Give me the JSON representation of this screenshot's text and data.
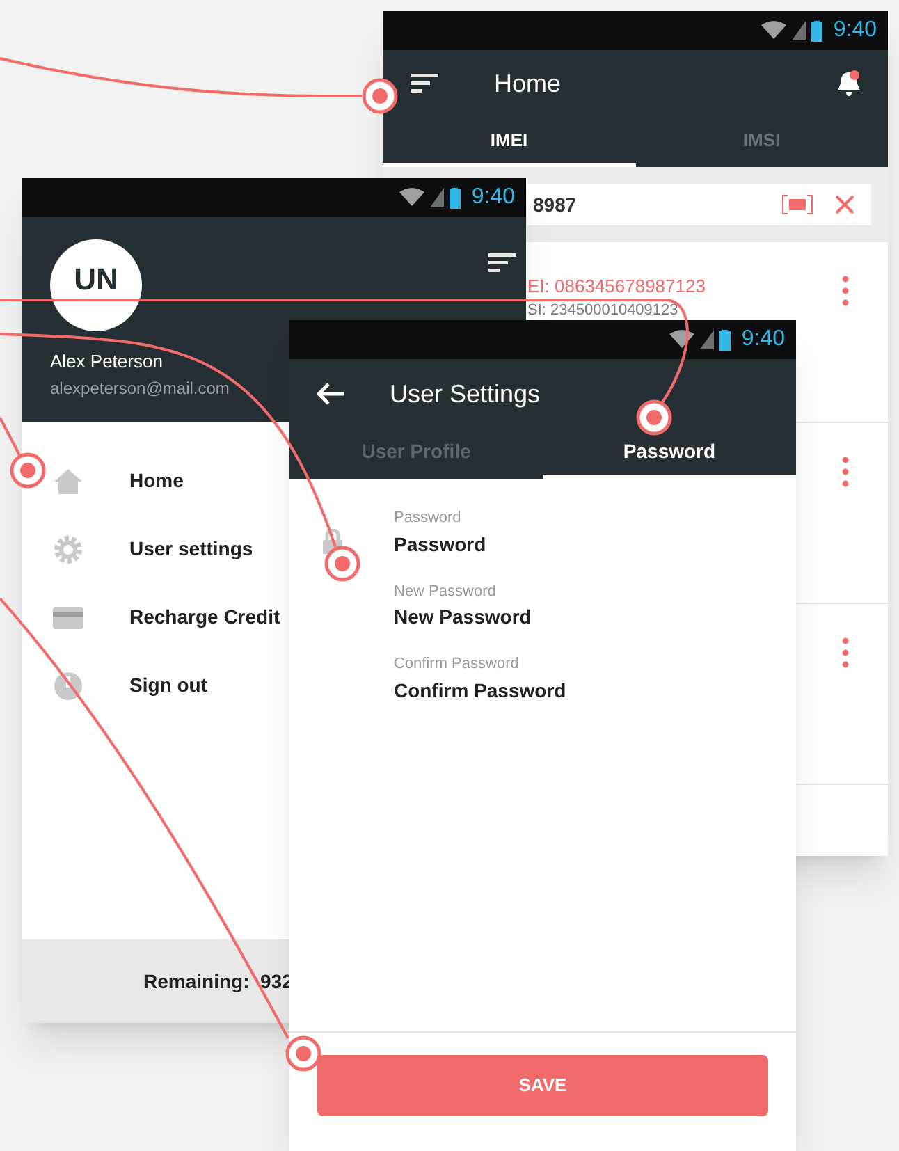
{
  "home_screen": {
    "status_time": "9:40",
    "title": "Home",
    "tabs": [
      {
        "label": "IMEI",
        "selected": true
      },
      {
        "label": "IMSI",
        "selected": false
      }
    ],
    "search": {
      "value": "8987"
    },
    "rows": [
      {
        "kind": "entry",
        "imei": "EI: 086345678987123",
        "imsi": "SI: 234500010409123"
      },
      {
        "kind": "blank"
      },
      {
        "kind": "blank"
      }
    ]
  },
  "drawer_screen": {
    "status_time": "9:40",
    "avatar_initials": "UN",
    "user_name": "Alex Peterson",
    "email": "alexpeterson@mail.com",
    "menu": [
      {
        "label": "Home"
      },
      {
        "label": "User settings"
      },
      {
        "label": "Recharge Credit"
      },
      {
        "label": "Sign out"
      }
    ],
    "footer": "Remaining:  932"
  },
  "settings_screen": {
    "status_time": "9:40",
    "title": "User Settings",
    "tabs": [
      {
        "label": "User Profile",
        "selected": false
      },
      {
        "label": "Password",
        "selected": true
      }
    ],
    "fields": [
      {
        "label": "Password",
        "value": "Password"
      },
      {
        "label": "New Password",
        "value": "New Password"
      },
      {
        "label": "Confirm Password",
        "value": "Confirm Password"
      }
    ],
    "save_button": "SAVE"
  }
}
